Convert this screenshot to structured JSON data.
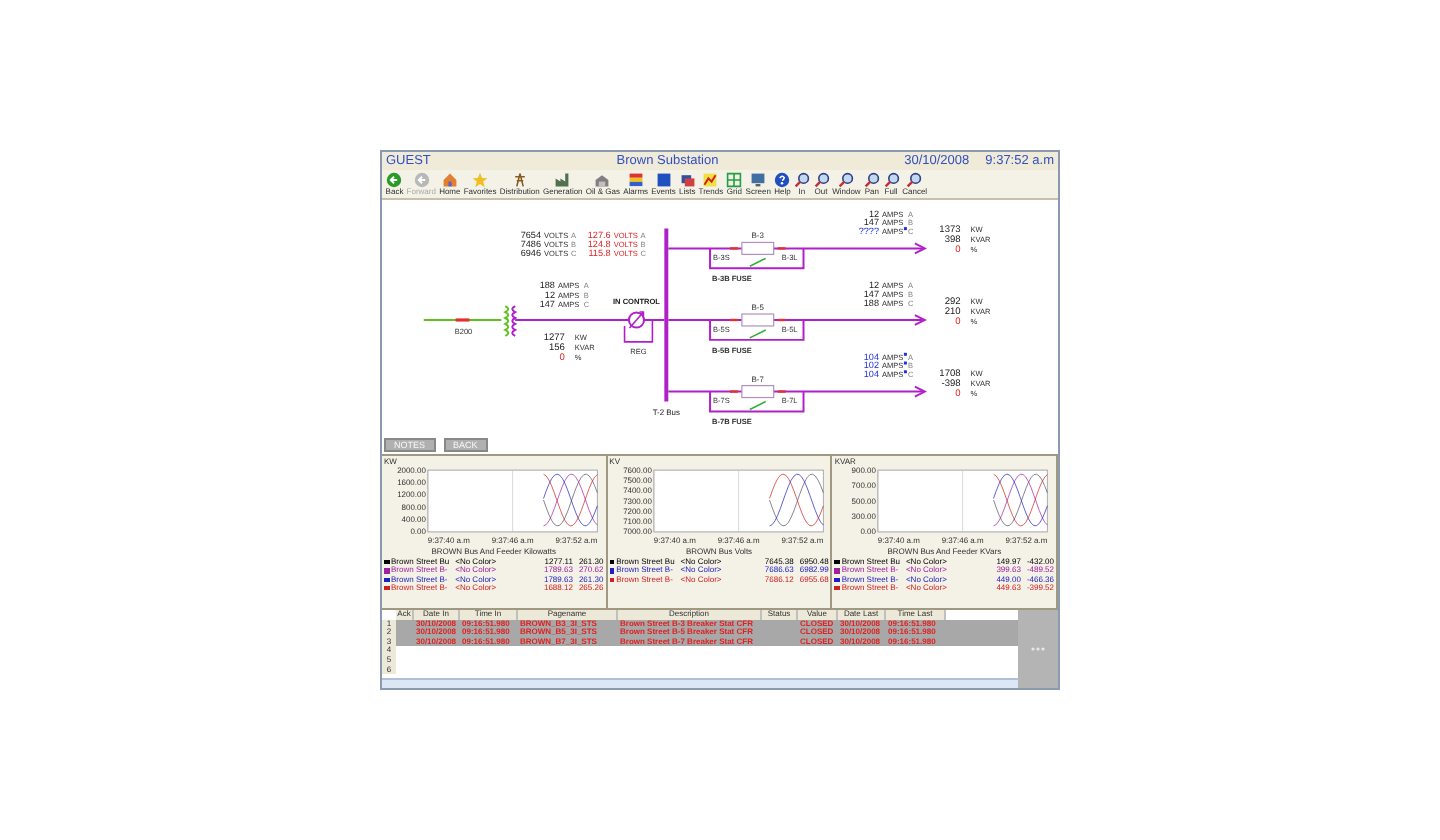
{
  "title_bar": {
    "user": "GUEST",
    "title": "Brown Substation",
    "date": "30/10/2008",
    "time": "9:37:52 a.m"
  },
  "toolbar": [
    {
      "label": "Back",
      "kind": "arrow",
      "disabled": false
    },
    {
      "label": "Forward",
      "kind": "arrow",
      "disabled": true
    },
    {
      "label": "Home",
      "kind": "house",
      "disabled": false
    },
    {
      "label": "Favorites",
      "kind": "star",
      "disabled": false
    },
    {
      "label": "Distribution",
      "kind": "tower",
      "disabled": false
    },
    {
      "label": "Generation",
      "kind": "factory",
      "disabled": false
    },
    {
      "label": "Oil & Gas",
      "kind": "building",
      "disabled": false
    },
    {
      "label": "Alarms",
      "kind": "palette",
      "disabled": false
    },
    {
      "label": "Events",
      "kind": "square",
      "disabled": false
    },
    {
      "label": "Lists",
      "kind": "folders",
      "disabled": false
    },
    {
      "label": "Trends",
      "kind": "trend",
      "disabled": false
    },
    {
      "label": "Grid",
      "kind": "grid",
      "disabled": false
    },
    {
      "label": "Screen",
      "kind": "monitor",
      "disabled": false
    },
    {
      "label": "Help",
      "kind": "help",
      "disabled": false
    },
    {
      "label": "In",
      "kind": "magnifier",
      "disabled": false
    },
    {
      "label": "Out",
      "kind": "magnifier",
      "disabled": false
    },
    {
      "label": "Window",
      "kind": "magnifier",
      "disabled": false
    },
    {
      "label": "Pan",
      "kind": "magnifier",
      "disabled": false
    },
    {
      "label": "Full",
      "kind": "magnifier",
      "disabled": false
    },
    {
      "label": "Cancel",
      "kind": "magnifier",
      "disabled": false
    }
  ],
  "diagram": {
    "voltages": [
      {
        "primary": "7654",
        "unit": "VOLTS",
        "phase": "A",
        "secondary": "127.6",
        "secondary_unit": "VOLTS",
        "secondary_phase": "A"
      },
      {
        "primary": "7486",
        "unit": "VOLTS",
        "phase": "B",
        "secondary": "124.8",
        "secondary_unit": "VOLTS",
        "secondary_phase": "B"
      },
      {
        "primary": "6946",
        "unit": "VOLTS",
        "phase": "C",
        "secondary": "115.8",
        "secondary_unit": "VOLTS",
        "secondary_phase": "C"
      }
    ],
    "amps": [
      {
        "value": "188",
        "unit": "AMPS",
        "phase": "A",
        "flagged": false
      },
      {
        "value": "12",
        "unit": "AMPS",
        "phase": "B",
        "flagged": false
      },
      {
        "value": "147",
        "unit": "AMPS",
        "phase": "C",
        "flagged": false
      }
    ],
    "power": [
      {
        "value": "1277",
        "unit": "KW",
        "alarm": false
      },
      {
        "value": "156",
        "unit": "KVAR",
        "alarm": false
      },
      {
        "value": "0",
        "unit": "%",
        "alarm": true
      }
    ],
    "source_label": "B200",
    "regulator_status": "IN CONTROL",
    "regulator_label": "REG",
    "bus_label": "T-2 Bus",
    "feeders": [
      {
        "breaker": "B-3",
        "source_switch": "B-3S",
        "load_switch": "B-3L",
        "fuse": "B-3B FUSE",
        "amps": [
          {
            "value": "12",
            "unit": "AMPS",
            "phase": "A",
            "flagged": false
          },
          {
            "value": "147",
            "unit": "AMPS",
            "phase": "B",
            "flagged": false
          },
          {
            "value": "????",
            "unit": "AMPS",
            "phase": "C",
            "flagged": true
          }
        ],
        "power": [
          {
            "value": "1373",
            "unit": "KW",
            "alarm": false
          },
          {
            "value": "398",
            "unit": "KVAR",
            "alarm": false
          },
          {
            "value": "0",
            "unit": "%",
            "alarm": true
          }
        ]
      },
      {
        "breaker": "B-5",
        "source_switch": "B-5S",
        "load_switch": "B-5L",
        "fuse": "B-5B FUSE",
        "amps": [
          {
            "value": "12",
            "unit": "AMPS",
            "phase": "A",
            "flagged": false
          },
          {
            "value": "147",
            "unit": "AMPS",
            "phase": "B",
            "flagged": false
          },
          {
            "value": "188",
            "unit": "AMPS",
            "phase": "C",
            "flagged": false
          }
        ],
        "power": [
          {
            "value": "292",
            "unit": "KW",
            "alarm": false
          },
          {
            "value": "210",
            "unit": "KVAR",
            "alarm": false
          },
          {
            "value": "0",
            "unit": "%",
            "alarm": true
          }
        ]
      },
      {
        "breaker": "B-7",
        "source_switch": "B-7S",
        "load_switch": "B-7L",
        "fuse": "B-7B FUSE",
        "amps": [
          {
            "value": "104",
            "unit": "AMPS",
            "phase": "A",
            "flagged": true
          },
          {
            "value": "102",
            "unit": "AMPS",
            "phase": "B",
            "flagged": true
          },
          {
            "value": "104",
            "unit": "AMPS",
            "phase": "C",
            "flagged": true
          }
        ],
        "power": [
          {
            "value": "1708",
            "unit": "KW",
            "alarm": false
          },
          {
            "value": "-398",
            "unit": "KVAR",
            "alarm": false
          },
          {
            "value": "0",
            "unit": "%",
            "alarm": true
          }
        ]
      }
    ]
  },
  "buttons": [
    "NOTES",
    "BACK"
  ],
  "trend_panels": [
    {
      "unit_label": "KW",
      "title": "BROWN Bus And Feeder Kilowatts",
      "y_ticks": [
        "2000.00",
        "1600.00",
        "1200.00",
        "800.00",
        "400.00",
        "0.00"
      ],
      "x_ticks": [
        "9:37:40 a.m",
        "9:37:46 a.m",
        "9:37:52 a.m"
      ],
      "legend": [
        {
          "name": "Brown Street Bu",
          "color_name": "<No Color>",
          "value": "1277.11",
          "min": "261.30",
          "color": "#000000"
        },
        {
          "name": "Brown Street B-",
          "color_name": "<No Color>",
          "value": "1789.63",
          "min": "270.62",
          "color": "#a020a0"
        },
        {
          "name": "Brown Street B-",
          "color_name": "<No Color>",
          "value": "1789.63",
          "min": "261.30",
          "color": "#2020c0"
        },
        {
          "name": "Brown Street B-",
          "color_name": "<No Color>",
          "value": "1688.12",
          "min": "265.26",
          "color": "#d02020"
        }
      ]
    },
    {
      "unit_label": "KV",
      "title": "BROWN Bus Volts",
      "y_ticks": [
        "7600.00",
        "7500.00",
        "7400.00",
        "7300.00",
        "7200.00",
        "7100.00",
        "7000.00"
      ],
      "x_ticks": [
        "9:37:40 a.m",
        "9:37:46 a.m",
        "9:37:52 a.m"
      ],
      "legend": [
        {
          "name": "Brown Street Bu",
          "color_name": "<No Color>",
          "value": "7645.38",
          "min": "6950.48",
          "color": "#000000"
        },
        {
          "name": "Brown Street B-",
          "color_name": "<No Color>",
          "value": "7686.63",
          "min": "6982.99",
          "color": "#2020c0"
        },
        {
          "name": "Brown Street B-",
          "color_name": "<No Color>",
          "value": "7686.12",
          "min": "6955.68",
          "color": "#d02020"
        }
      ]
    },
    {
      "unit_label": "KVAR",
      "title": "BROWN Bus And Feeder KVars",
      "y_ticks": [
        "900.00",
        "700.00",
        "500.00",
        "300.00",
        "0.00"
      ],
      "x_ticks": [
        "9:37:40 a.m",
        "9:37:46 a.m",
        "9:37:52 a.m"
      ],
      "legend": [
        {
          "name": "Brown Street Bu",
          "color_name": "<No Color>",
          "value": "149.97",
          "min": "-432.00",
          "color": "#000000"
        },
        {
          "name": "Brown Street B-",
          "color_name": "<No Color>",
          "value": "399.63",
          "min": "-489.52",
          "color": "#a020a0"
        },
        {
          "name": "Brown Street B-",
          "color_name": "<No Color>",
          "value": "449.00",
          "min": "-466.36",
          "color": "#2020c0"
        },
        {
          "name": "Brown Street B-",
          "color_name": "<No Color>",
          "value": "449.63",
          "min": "-399.52",
          "color": "#d02020"
        }
      ]
    }
  ],
  "alarm_table": {
    "columns": [
      "Ack",
      "Date In",
      "Time In",
      "Pagename",
      "Description",
      "Status",
      "Value",
      "Date Last",
      "Time Last"
    ],
    "rows": [
      {
        "index": "1",
        "selected": true,
        "date_in": "30/10/2008",
        "time_in": "09:16:51.980",
        "pagename": "BROWN_B3_3I_STS",
        "description": "Brown Street B-3 Breaker Stat CFR",
        "value": "CLOSED",
        "date_last": "30/10/2008",
        "time_last": "09:16:51.980"
      },
      {
        "index": "2",
        "selected": true,
        "date_in": "30/10/2008",
        "time_in": "09:16:51.980",
        "pagename": "BROWN_B5_3I_STS",
        "description": "Brown Street B-5 Breaker Stat CFR",
        "value": "CLOSED",
        "date_last": "30/10/2008",
        "time_last": "09:16:51.980"
      },
      {
        "index": "3",
        "selected": true,
        "date_in": "30/10/2008",
        "time_in": "09:16:51.980",
        "pagename": "BROWN_B7_3I_STS",
        "description": "Brown Street B-7 Breaker Stat CFR",
        "value": "CLOSED",
        "date_last": "30/10/2008",
        "time_last": "09:16:51.980"
      },
      {
        "index": "4",
        "selected": false
      },
      {
        "index": "5",
        "selected": false
      },
      {
        "index": "6",
        "selected": false
      }
    ]
  }
}
